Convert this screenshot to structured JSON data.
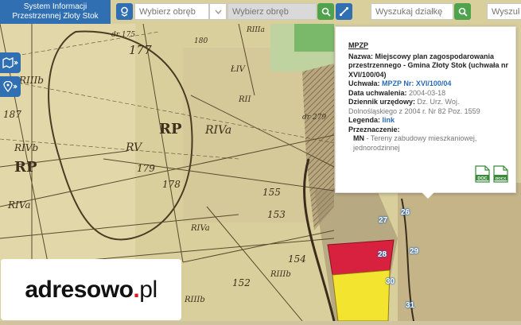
{
  "app": {
    "title": "System Informacji Przestrzennej Złoty Stok"
  },
  "toolbar": {
    "precinct_select_placeholder": "Wybierz obręb",
    "precinct_input_placeholder": "Wybierz obręb",
    "parcel_search_placeholder": "Wyszukaj działkę",
    "address_search_placeholder": "Wyszukaj"
  },
  "map": {
    "parcel_labels": [
      "177",
      "187",
      "RIIIb",
      "RP",
      "RIVa",
      "RV",
      "178",
      "179",
      "RIVb",
      "RP",
      "RIVa",
      "155",
      "153",
      "152",
      "154",
      "RIIIb",
      "RIVa",
      "RIIIb",
      "dr 175",
      "180",
      "RIIIa",
      "ŁIV",
      "RII",
      "dr 279"
    ],
    "plot_numbers": [
      "26",
      "27",
      "28",
      "29",
      "30",
      "31"
    ]
  },
  "popup": {
    "heading": "MPZP",
    "name_label": "Nazwa:",
    "name_value": "Miejscowy plan zagospodarowania przestrzennego - Gmina Złoty Stok (uchwała nr XVI/100/04)",
    "resolution_label": "Uchwała:",
    "resolution_link": "MPZP Nr: XVI/100/04",
    "date_label": "Data uchwalenia:",
    "date_value": "2004-03-18",
    "journal_label": "Dziennik urzędowy:",
    "journal_value": "Dz. Urz. Woj. Dolnośląskiego z 2004 r. Nr 82 Poz. 1559",
    "legend_label": "Legenda:",
    "legend_link": "link",
    "purpose_label": "Przeznaczenie:",
    "purpose_code": "MN",
    "purpose_value": "- Tereny zabudowy mieszkaniowej, jednorodzinnej",
    "doc_label": "DOC",
    "docx_label": "DOCX"
  },
  "watermark": {
    "main": "adresowo",
    "dot": ".",
    "tld": "pl"
  },
  "colors": {
    "accent": "#2f6fb2",
    "search_green": "#4fa34c",
    "zone_red": "#d8213f",
    "zone_yellow": "#f3e52f"
  }
}
